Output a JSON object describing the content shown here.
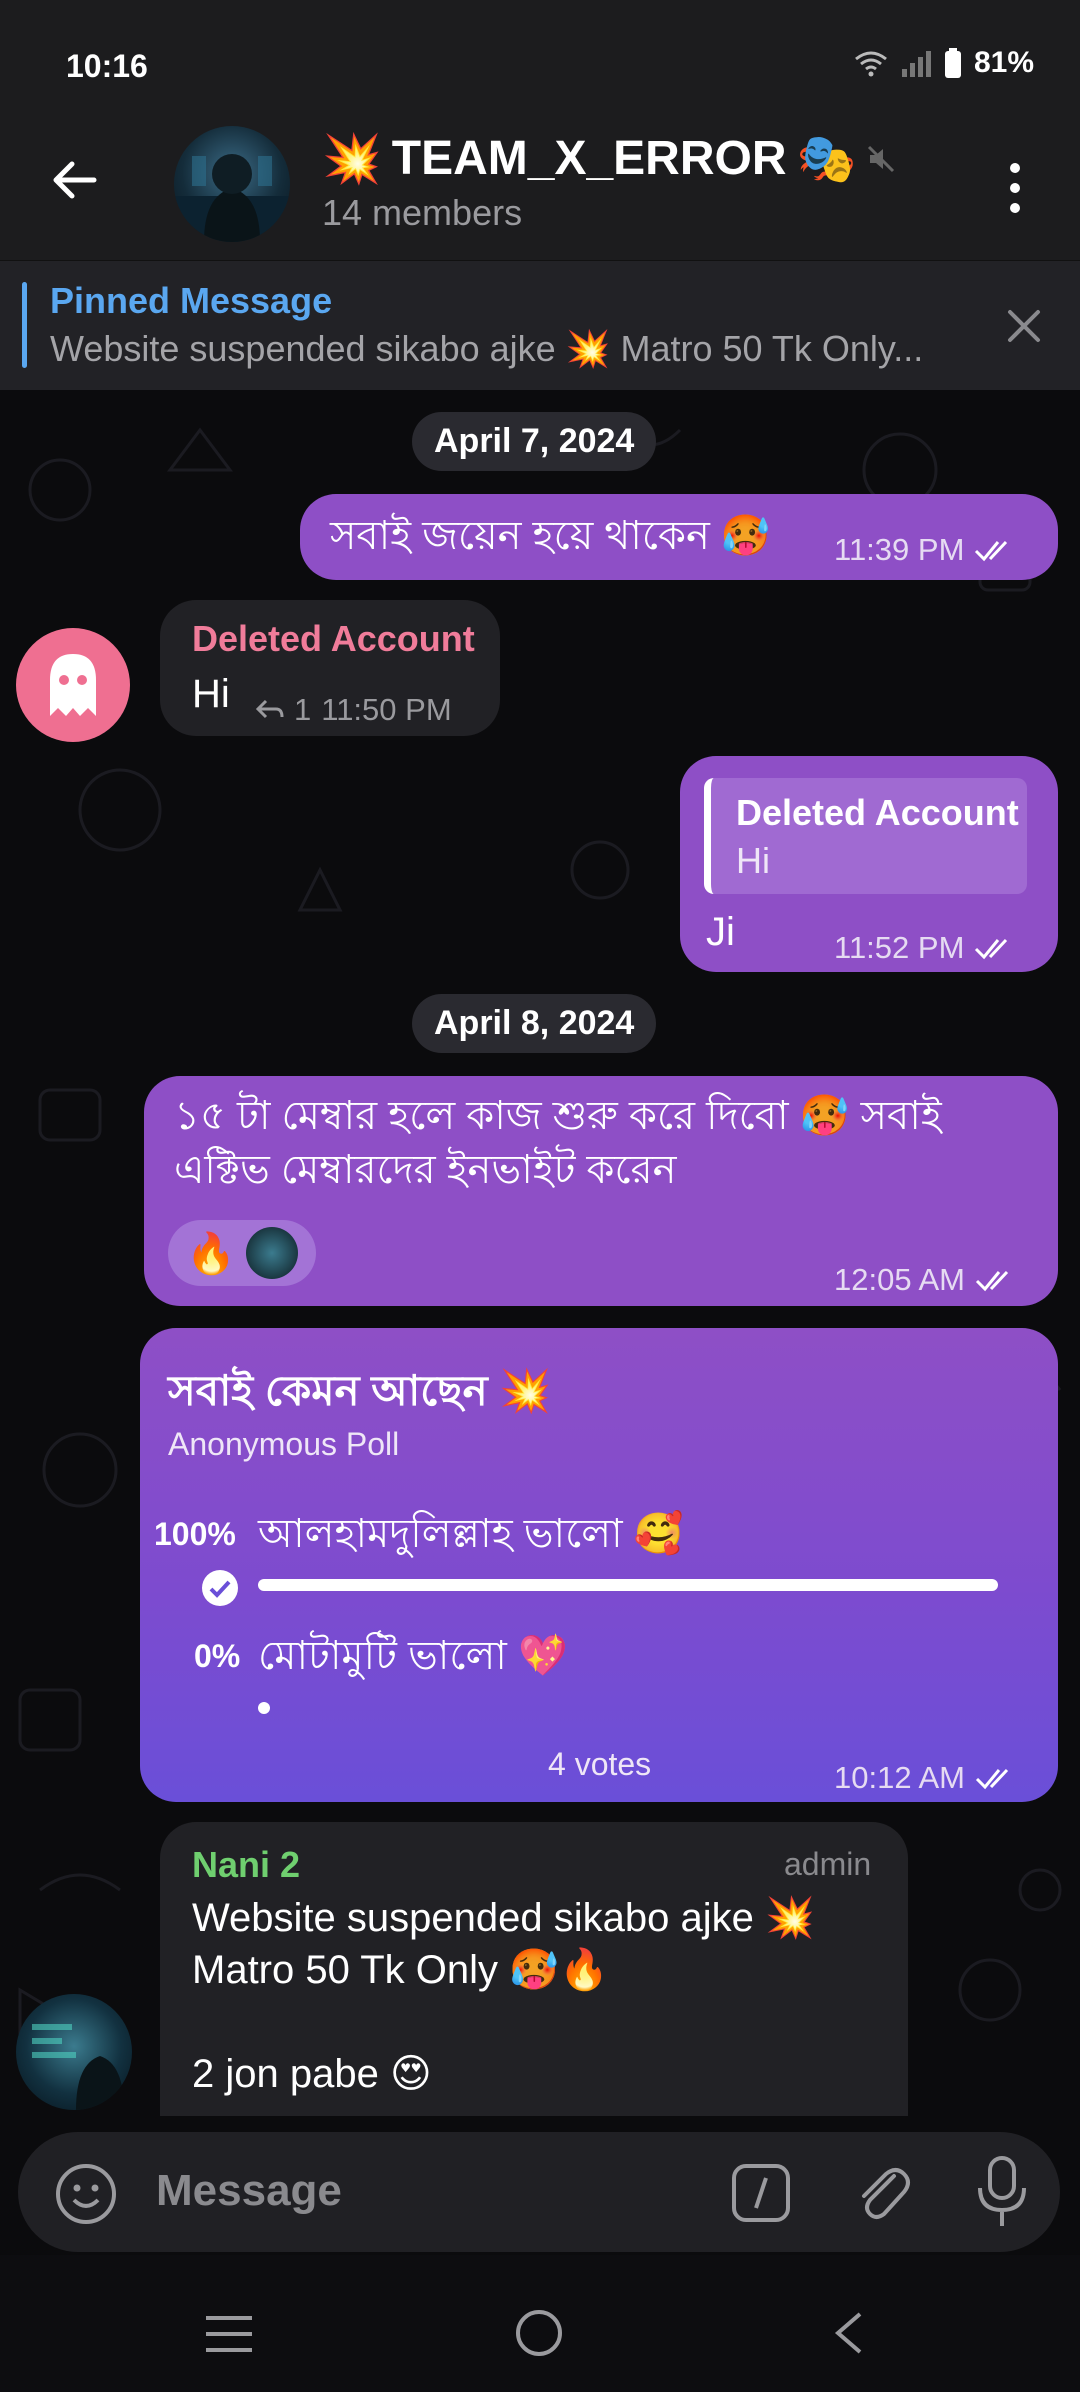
{
  "status": {
    "time": "10:16",
    "battery": "81%"
  },
  "header": {
    "title": "TEAM_X_ERROR",
    "subtitle": "14 members"
  },
  "pinned": {
    "title": "Pinned Message",
    "text": "Website suspended sikabo ajke 💥 Matro 50 Tk Only..."
  },
  "dates": [
    "April 7, 2024",
    "April 8, 2024"
  ],
  "messages": {
    "m1": {
      "text": "সবাই জয়েন হয়ে থাকেন 🥵",
      "time": "11:39 PM"
    },
    "m2": {
      "sender": "Deleted Account",
      "text": "Hi",
      "replies": "1",
      "time": "11:50 PM"
    },
    "m3": {
      "quote_sender": "Deleted Account",
      "quote_text": "Hi",
      "text": "Ji",
      "time": "11:52 PM"
    },
    "m4": {
      "line1": "১৫ টা মেম্বার হলে কাজ শুরু করে দিবো 🥵 সবাই",
      "line2": "এক্টিভ মেম্বারদের ইনভাইট করেন",
      "reaction": "🔥",
      "time": "12:05 AM"
    },
    "m6": {
      "sender": "Nani 2",
      "role": "admin",
      "line1": "Website suspended sikabo ajke 💥",
      "line2": "Matro 50 Tk Only 🥵🔥",
      "line3": "2 jon pabe 😍"
    }
  },
  "poll": {
    "question": "সবাই কেমন আছেন 💥",
    "type": "Anonymous Poll",
    "options": [
      {
        "percent": "100%",
        "label": "আলহামদুলিল্লাহ ভালো 🥰",
        "fraction": 1.0
      },
      {
        "percent": "0%",
        "label": "মোটামুটি ভালো 💖",
        "fraction": 0.0
      }
    ],
    "votes": "4 votes",
    "time": "10:12 AM"
  },
  "composer": {
    "placeholder": "Message"
  },
  "colors": {
    "outgoing": "#8e4fc6",
    "incoming": "#212125",
    "accent": "#5aa7f0",
    "deleted_name": "#f07c9a",
    "nani_name": "#6fcf6f"
  }
}
